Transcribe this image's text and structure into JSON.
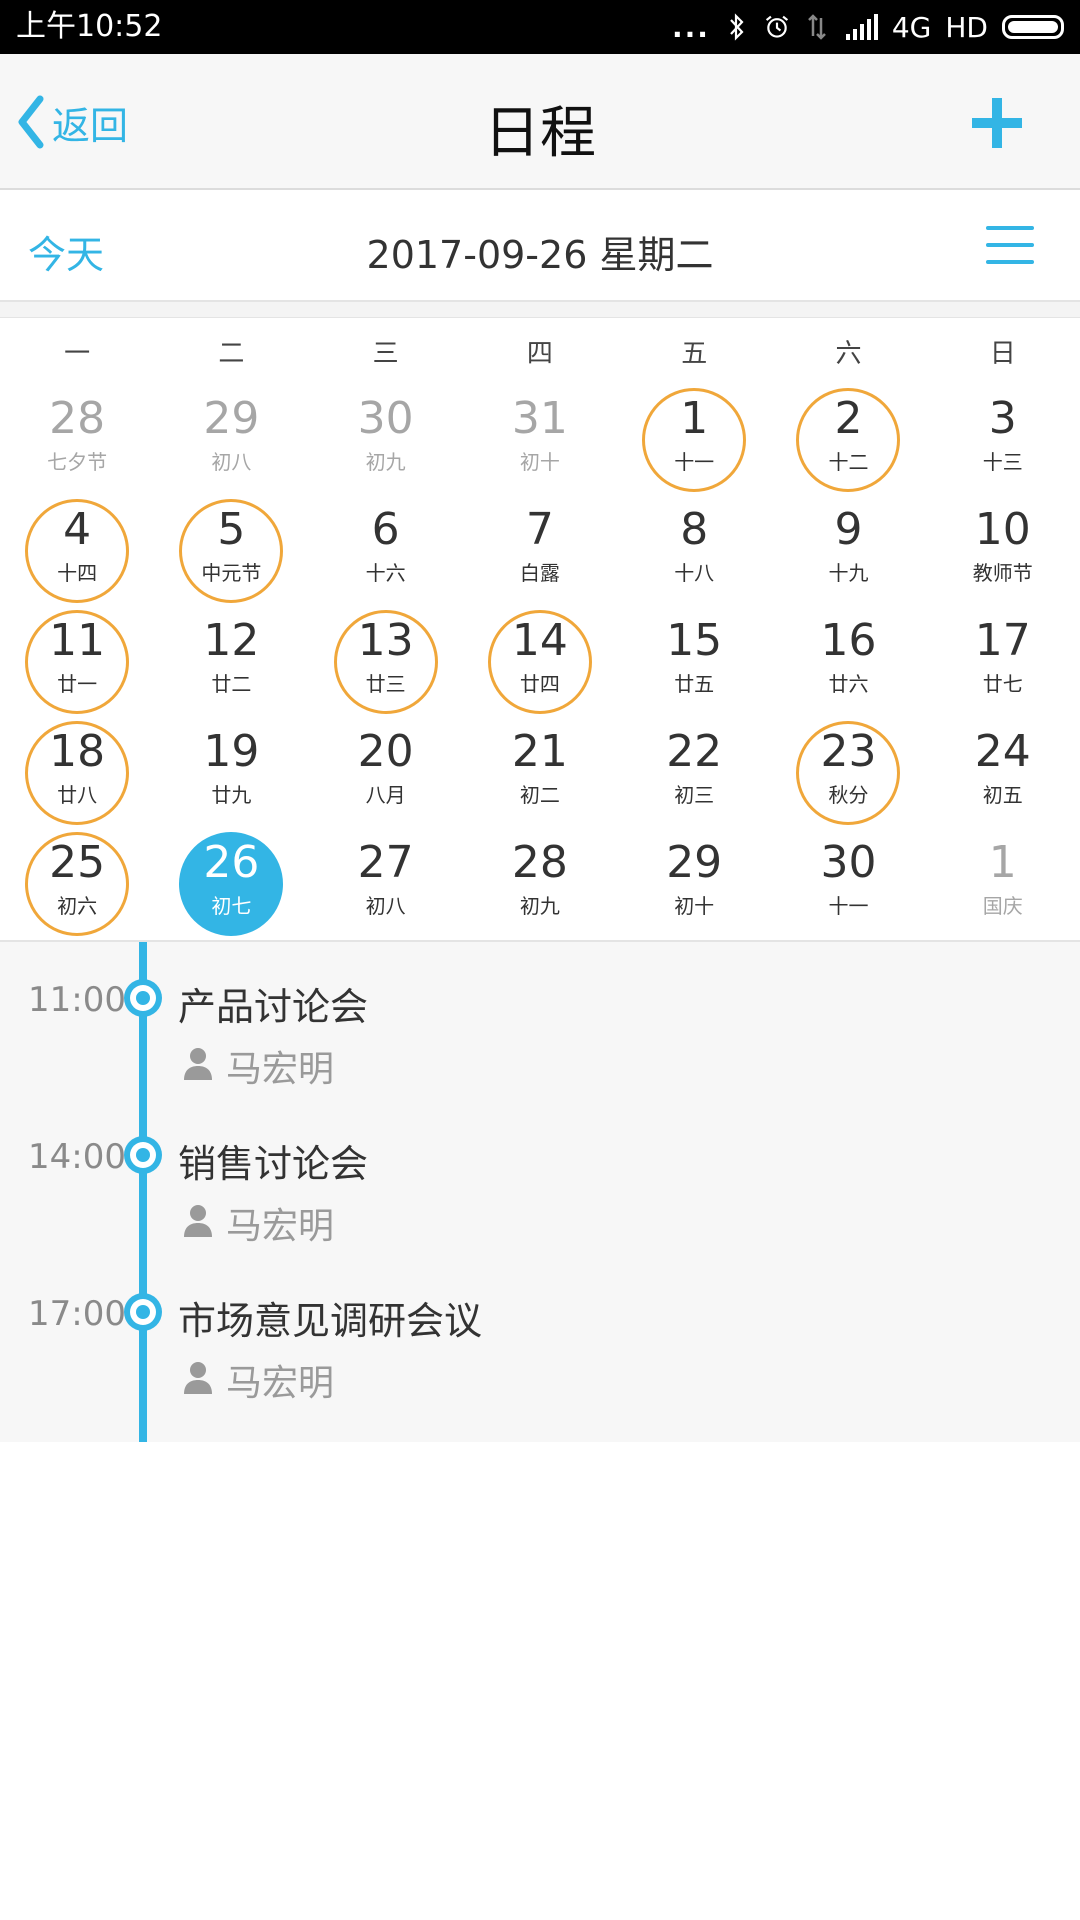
{
  "status_bar": {
    "time": "上午10:52",
    "dots": "...",
    "network": "4G",
    "hd": "HD",
    "icons": [
      "bluetooth-icon",
      "alarm-icon",
      "data-icon",
      "signal-icon",
      "battery-icon"
    ]
  },
  "header": {
    "back_label": "返回",
    "title": "日程",
    "add_icon": "plus-icon"
  },
  "toolbar": {
    "today_label": "今天",
    "current_date": "2017-09-26 星期二",
    "menu_icon": "menu-icon"
  },
  "colors": {
    "accent": "#33b5e5",
    "marked_ring": "#f0a73a",
    "dim_text": "#a6a6a6"
  },
  "calendar": {
    "weekdays": [
      "一",
      "二",
      "三",
      "四",
      "五",
      "六",
      "日"
    ],
    "days": [
      {
        "num": "28",
        "lunar": "七夕节",
        "dim": true,
        "marked": false,
        "selected": false
      },
      {
        "num": "29",
        "lunar": "初八",
        "dim": true,
        "marked": false,
        "selected": false
      },
      {
        "num": "30",
        "lunar": "初九",
        "dim": true,
        "marked": false,
        "selected": false
      },
      {
        "num": "31",
        "lunar": "初十",
        "dim": true,
        "marked": false,
        "selected": false
      },
      {
        "num": "1",
        "lunar": "十一",
        "dim": false,
        "marked": true,
        "selected": false
      },
      {
        "num": "2",
        "lunar": "十二",
        "dim": false,
        "marked": true,
        "selected": false
      },
      {
        "num": "3",
        "lunar": "十三",
        "dim": false,
        "marked": false,
        "selected": false
      },
      {
        "num": "4",
        "lunar": "十四",
        "dim": false,
        "marked": true,
        "selected": false
      },
      {
        "num": "5",
        "lunar": "中元节",
        "dim": false,
        "marked": true,
        "selected": false
      },
      {
        "num": "6",
        "lunar": "十六",
        "dim": false,
        "marked": false,
        "selected": false
      },
      {
        "num": "7",
        "lunar": "白露",
        "dim": false,
        "marked": false,
        "selected": false
      },
      {
        "num": "8",
        "lunar": "十八",
        "dim": false,
        "marked": false,
        "selected": false
      },
      {
        "num": "9",
        "lunar": "十九",
        "dim": false,
        "marked": false,
        "selected": false
      },
      {
        "num": "10",
        "lunar": "教师节",
        "dim": false,
        "marked": false,
        "selected": false
      },
      {
        "num": "11",
        "lunar": "廿一",
        "dim": false,
        "marked": true,
        "selected": false
      },
      {
        "num": "12",
        "lunar": "廿二",
        "dim": false,
        "marked": false,
        "selected": false
      },
      {
        "num": "13",
        "lunar": "廿三",
        "dim": false,
        "marked": true,
        "selected": false
      },
      {
        "num": "14",
        "lunar": "廿四",
        "dim": false,
        "marked": true,
        "selected": false
      },
      {
        "num": "15",
        "lunar": "廿五",
        "dim": false,
        "marked": false,
        "selected": false
      },
      {
        "num": "16",
        "lunar": "廿六",
        "dim": false,
        "marked": false,
        "selected": false
      },
      {
        "num": "17",
        "lunar": "廿七",
        "dim": false,
        "marked": false,
        "selected": false
      },
      {
        "num": "18",
        "lunar": "廿八",
        "dim": false,
        "marked": true,
        "selected": false
      },
      {
        "num": "19",
        "lunar": "廿九",
        "dim": false,
        "marked": false,
        "selected": false
      },
      {
        "num": "20",
        "lunar": "八月",
        "dim": false,
        "marked": false,
        "selected": false
      },
      {
        "num": "21",
        "lunar": "初二",
        "dim": false,
        "marked": false,
        "selected": false
      },
      {
        "num": "22",
        "lunar": "初三",
        "dim": false,
        "marked": false,
        "selected": false
      },
      {
        "num": "23",
        "lunar": "秋分",
        "dim": false,
        "marked": true,
        "selected": false
      },
      {
        "num": "24",
        "lunar": "初五",
        "dim": false,
        "marked": false,
        "selected": false
      },
      {
        "num": "25",
        "lunar": "初六",
        "dim": false,
        "marked": true,
        "selected": false
      },
      {
        "num": "26",
        "lunar": "初七",
        "dim": false,
        "marked": false,
        "selected": true
      },
      {
        "num": "27",
        "lunar": "初八",
        "dim": false,
        "marked": false,
        "selected": false
      },
      {
        "num": "28",
        "lunar": "初九",
        "dim": false,
        "marked": false,
        "selected": false
      },
      {
        "num": "29",
        "lunar": "初十",
        "dim": false,
        "marked": false,
        "selected": false
      },
      {
        "num": "30",
        "lunar": "十一",
        "dim": false,
        "marked": false,
        "selected": false
      },
      {
        "num": "1",
        "lunar": "国庆",
        "dim": true,
        "marked": false,
        "selected": false
      }
    ]
  },
  "schedule": {
    "events": [
      {
        "time": "11:00",
        "title": "产品讨论会",
        "person": "马宏明"
      },
      {
        "time": "14:00",
        "title": "销售讨论会",
        "person": "马宏明"
      },
      {
        "time": "17:00",
        "title": "市场意见调研会议",
        "person": "马宏明"
      }
    ]
  }
}
